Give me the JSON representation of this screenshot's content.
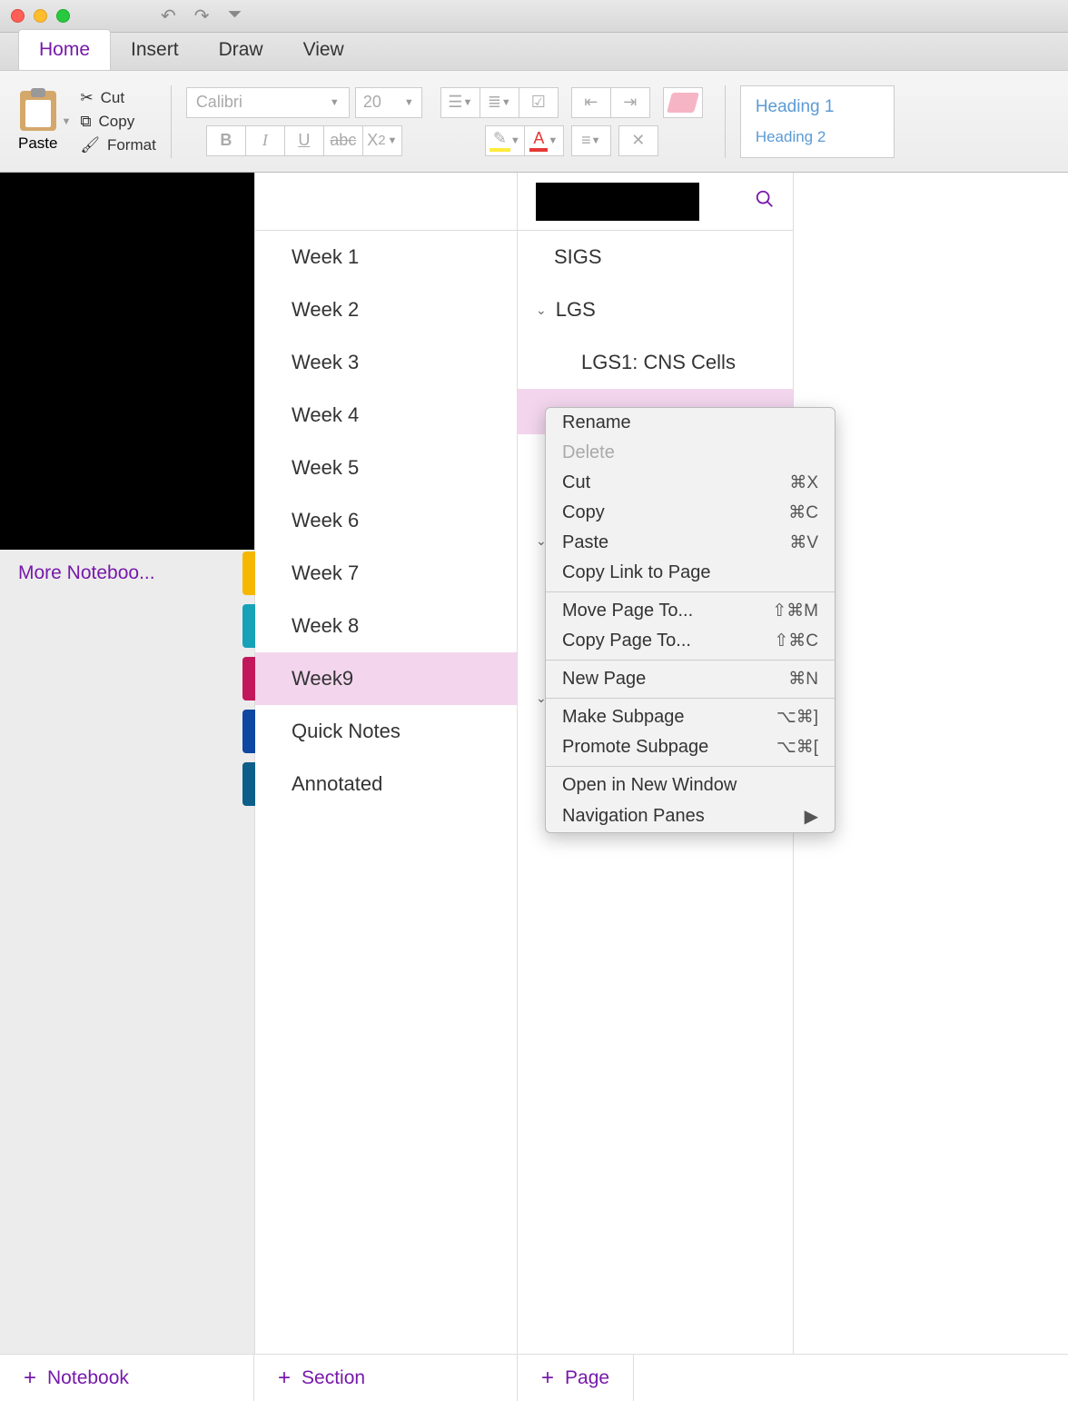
{
  "tabs": {
    "home": "Home",
    "insert": "Insert",
    "draw": "Draw",
    "view": "View"
  },
  "clipboard": {
    "paste": "Paste",
    "cut": "Cut",
    "copy": "Copy",
    "format": "Format"
  },
  "font": {
    "name": "Calibri",
    "size": "20"
  },
  "format_buttons": {
    "bold": "B",
    "italic": "I",
    "underline": "U",
    "strike": "abc",
    "sub": "X",
    "sub2": "2"
  },
  "styles": {
    "h1": "Heading 1",
    "h2": "Heading 2"
  },
  "notebooks": {
    "more": "More Noteboo..."
  },
  "sections": [
    {
      "label": "Week 1"
    },
    {
      "label": "Week 2"
    },
    {
      "label": "Week 3"
    },
    {
      "label": "Week 4"
    },
    {
      "label": "Week 5"
    },
    {
      "label": "Week 6"
    },
    {
      "label": "Week 7",
      "color": "#f5b700"
    },
    {
      "label": "Week 8",
      "color": "#17a2b8"
    },
    {
      "label": "Week9",
      "color": "#c2185b",
      "selected": true
    },
    {
      "label": "Quick Notes",
      "color": "#0d47a1"
    },
    {
      "label": "Annotated",
      "color": "#0d5f8a"
    }
  ],
  "pages": {
    "sigs": "SIGS",
    "lgs": "LGS",
    "lgs1": "LGS1: CNS Cells"
  },
  "context_menu": {
    "rename": "Rename",
    "delete": "Delete",
    "cut": "Cut",
    "cut_sc": "⌘X",
    "copy": "Copy",
    "copy_sc": "⌘C",
    "paste": "Paste",
    "paste_sc": "⌘V",
    "copylink": "Copy Link to Page",
    "moveto": "Move Page To...",
    "moveto_sc": "⇧⌘M",
    "copyto": "Copy Page To...",
    "copyto_sc": "⇧⌘C",
    "newpage": "New Page",
    "newpage_sc": "⌘N",
    "makesub": "Make Subpage",
    "makesub_sc": "⌥⌘]",
    "promote": "Promote Subpage",
    "promote_sc": "⌥⌘[",
    "opennew": "Open in New Window",
    "navpanes": "Navigation Panes"
  },
  "footer": {
    "notebook": "Notebook",
    "section": "Section",
    "page": "Page"
  }
}
